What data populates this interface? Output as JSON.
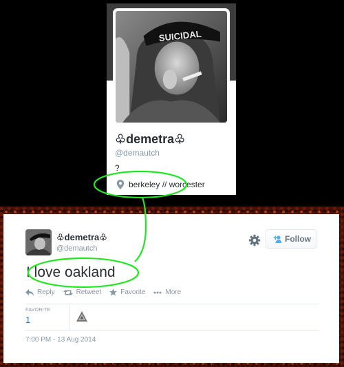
{
  "profile_card": {
    "name": "♧demetra♧",
    "handle": "@demautch",
    "bio": "?",
    "location": "berkeley // worcester",
    "location_icon": "map-pin-icon",
    "cap_text": "SUICIDAL"
  },
  "tweet": {
    "author_name": "♧demetra♧",
    "author_handle": "@demautch",
    "text": "I love oakland",
    "follow_label": "Follow",
    "actions": {
      "reply": "Reply",
      "retweet": "Retweet",
      "favorite": "Favorite",
      "more": "More"
    },
    "stats": {
      "favorite_label": "FAVORITE",
      "favorite_count": "1"
    },
    "timestamp": "7:00 PM - 13 Aug 2014"
  },
  "annotation": {
    "color": "#22e622"
  },
  "colors": {
    "link_blue": "#2b7bb9",
    "muted": "#8899a6",
    "text": "#292f33"
  }
}
